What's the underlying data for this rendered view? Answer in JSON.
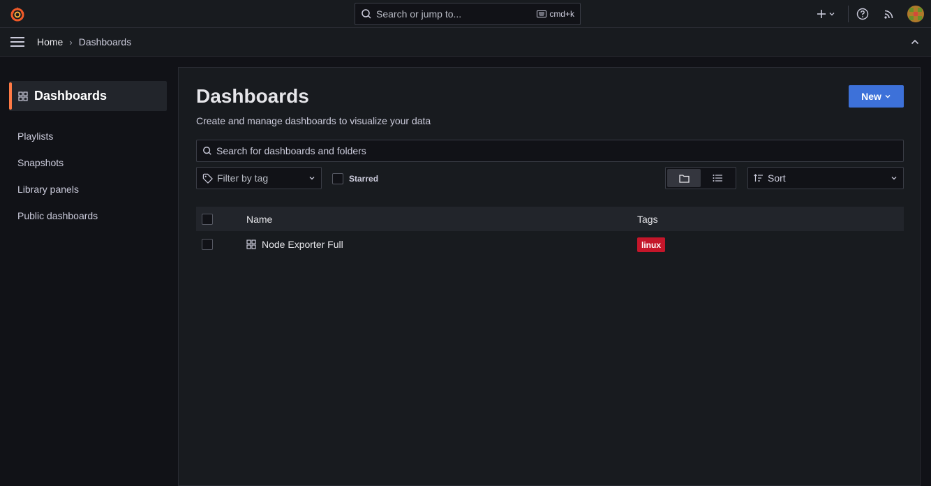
{
  "topbar": {
    "search_placeholder": "Search or jump to...",
    "shortcut": "cmd+k"
  },
  "breadcrumb": {
    "home": "Home",
    "separator": "›",
    "current": "Dashboards"
  },
  "sidebar": {
    "active": "Dashboards",
    "items": [
      "Playlists",
      "Snapshots",
      "Library panels",
      "Public dashboards"
    ]
  },
  "page": {
    "title": "Dashboards",
    "subtitle": "Create and manage dashboards to visualize your data",
    "new_button": "New",
    "search_placeholder": "Search for dashboards and folders",
    "filter_placeholder": "Filter by tag",
    "starred_label": "Starred",
    "sort_label": "Sort"
  },
  "table": {
    "columns": [
      "Name",
      "Tags"
    ],
    "rows": [
      {
        "name": "Node Exporter Full",
        "tags": [
          "linux"
        ]
      }
    ]
  },
  "colors": {
    "accent": "#ff7a45",
    "primary": "#3d71d9",
    "tag_linux": "#c4162a"
  }
}
